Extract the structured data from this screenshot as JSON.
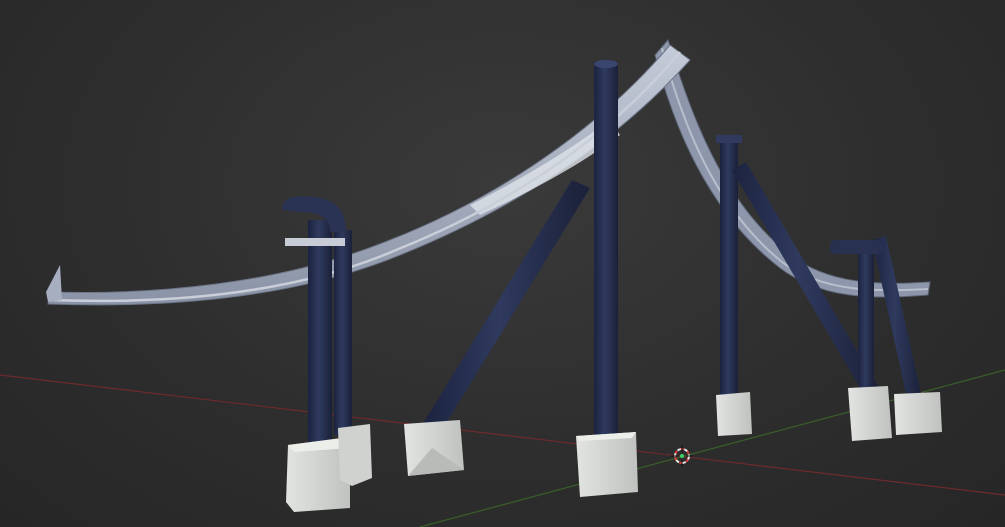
{
  "viewport": {
    "kind": "3d-viewport",
    "background_color": "#2e2e2e",
    "objects": [
      "roller-coaster-track",
      "support-pillars",
      "concrete-footings",
      "3d-cursor"
    ]
  },
  "colors": {
    "track": "#9aa3b5",
    "track_highlight": "#d7dce6",
    "pillar": "#283150",
    "footing": "#d9dbd8",
    "x_axis": "#7a2a2a",
    "y_axis": "#3d6a2a",
    "cursor_ring": "#e23c3c",
    "cursor_center": "#3cd16b"
  }
}
